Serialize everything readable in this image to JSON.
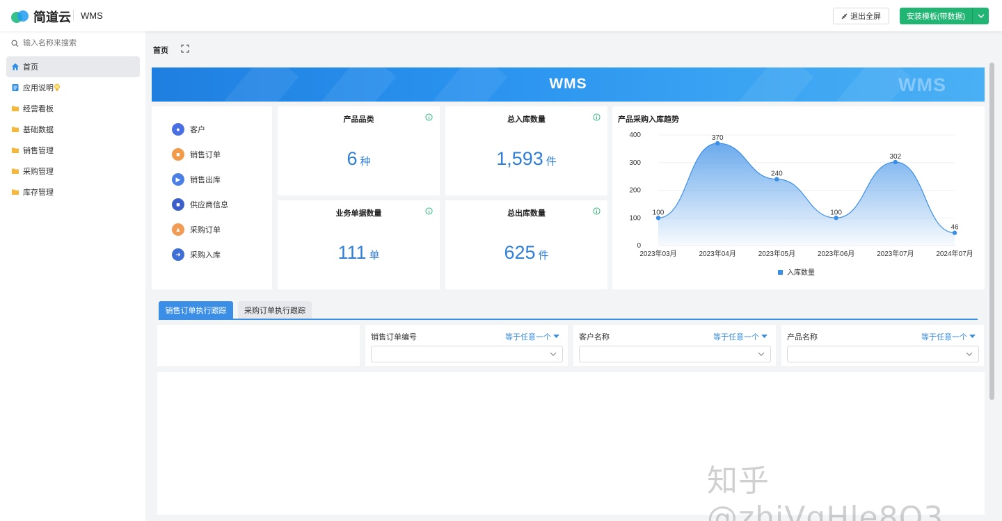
{
  "topbar": {
    "brand": "简道云",
    "app_name": "WMS",
    "exit_fullscreen_label": "退出全屏",
    "install_label": "安装模板(带数据)"
  },
  "sidebar": {
    "search_placeholder": "输入名称来搜索",
    "items": [
      {
        "label": "首页",
        "icon": "home-icon",
        "active": true
      },
      {
        "label": "应用说明",
        "icon": "doc-icon"
      },
      {
        "label": "经营看板",
        "icon": "folder-icon"
      },
      {
        "label": "基础数据",
        "icon": "folder-icon"
      },
      {
        "label": "销售管理",
        "icon": "folder-icon"
      },
      {
        "label": "采购管理",
        "icon": "folder-icon"
      },
      {
        "label": "库存管理",
        "icon": "folder-icon"
      }
    ]
  },
  "page_tab": {
    "label": "首页"
  },
  "banner": {
    "title": "WMS",
    "ghost_text": "WMS"
  },
  "quick_links": [
    {
      "label": "客户",
      "color": "#4a6fe3"
    },
    {
      "label": "销售订单",
      "color": "#f19a4a"
    },
    {
      "label": "销售出库",
      "color": "#4a7fe6"
    },
    {
      "label": "供应商信息",
      "color": "#3d5fc9"
    },
    {
      "label": "采购订单",
      "color": "#f29b55"
    },
    {
      "label": "采购入库",
      "color": "#3d6fd6"
    }
  ],
  "stats": {
    "category": {
      "title": "产品品类",
      "value": "6",
      "unit": "种"
    },
    "inbound": {
      "title": "总入库数量",
      "value": "1,593",
      "unit": "件"
    },
    "documents": {
      "title": "业务单据数量",
      "value": "111",
      "unit": "单"
    },
    "outbound": {
      "title": "总出库数量",
      "value": "625",
      "unit": "件"
    }
  },
  "chart_data": {
    "type": "area",
    "title": "产品采购入库趋势",
    "categories": [
      "2023年03月",
      "2023年04月",
      "2023年05月",
      "2023年06月",
      "2023年07月",
      "2024年07月"
    ],
    "series": [
      {
        "name": "入库数量",
        "values": [
          100,
          370,
          240,
          100,
          302,
          46
        ]
      }
    ],
    "ylim": [
      0,
      400
    ],
    "yticks": [
      0,
      100,
      200,
      300,
      400
    ],
    "legend": "bottom-center",
    "color": "#3a8ee6"
  },
  "section_tabs": {
    "active": "销售订单执行跟踪",
    "inactive": "采购订单执行跟踪"
  },
  "filters": [
    {
      "label": "销售订单编号",
      "op": "等于任意一个"
    },
    {
      "label": "客户名称",
      "op": "等于任意一个"
    },
    {
      "label": "产品名称",
      "op": "等于任意一个"
    }
  ],
  "watermark": "知乎 @zhiVgHle8O3"
}
